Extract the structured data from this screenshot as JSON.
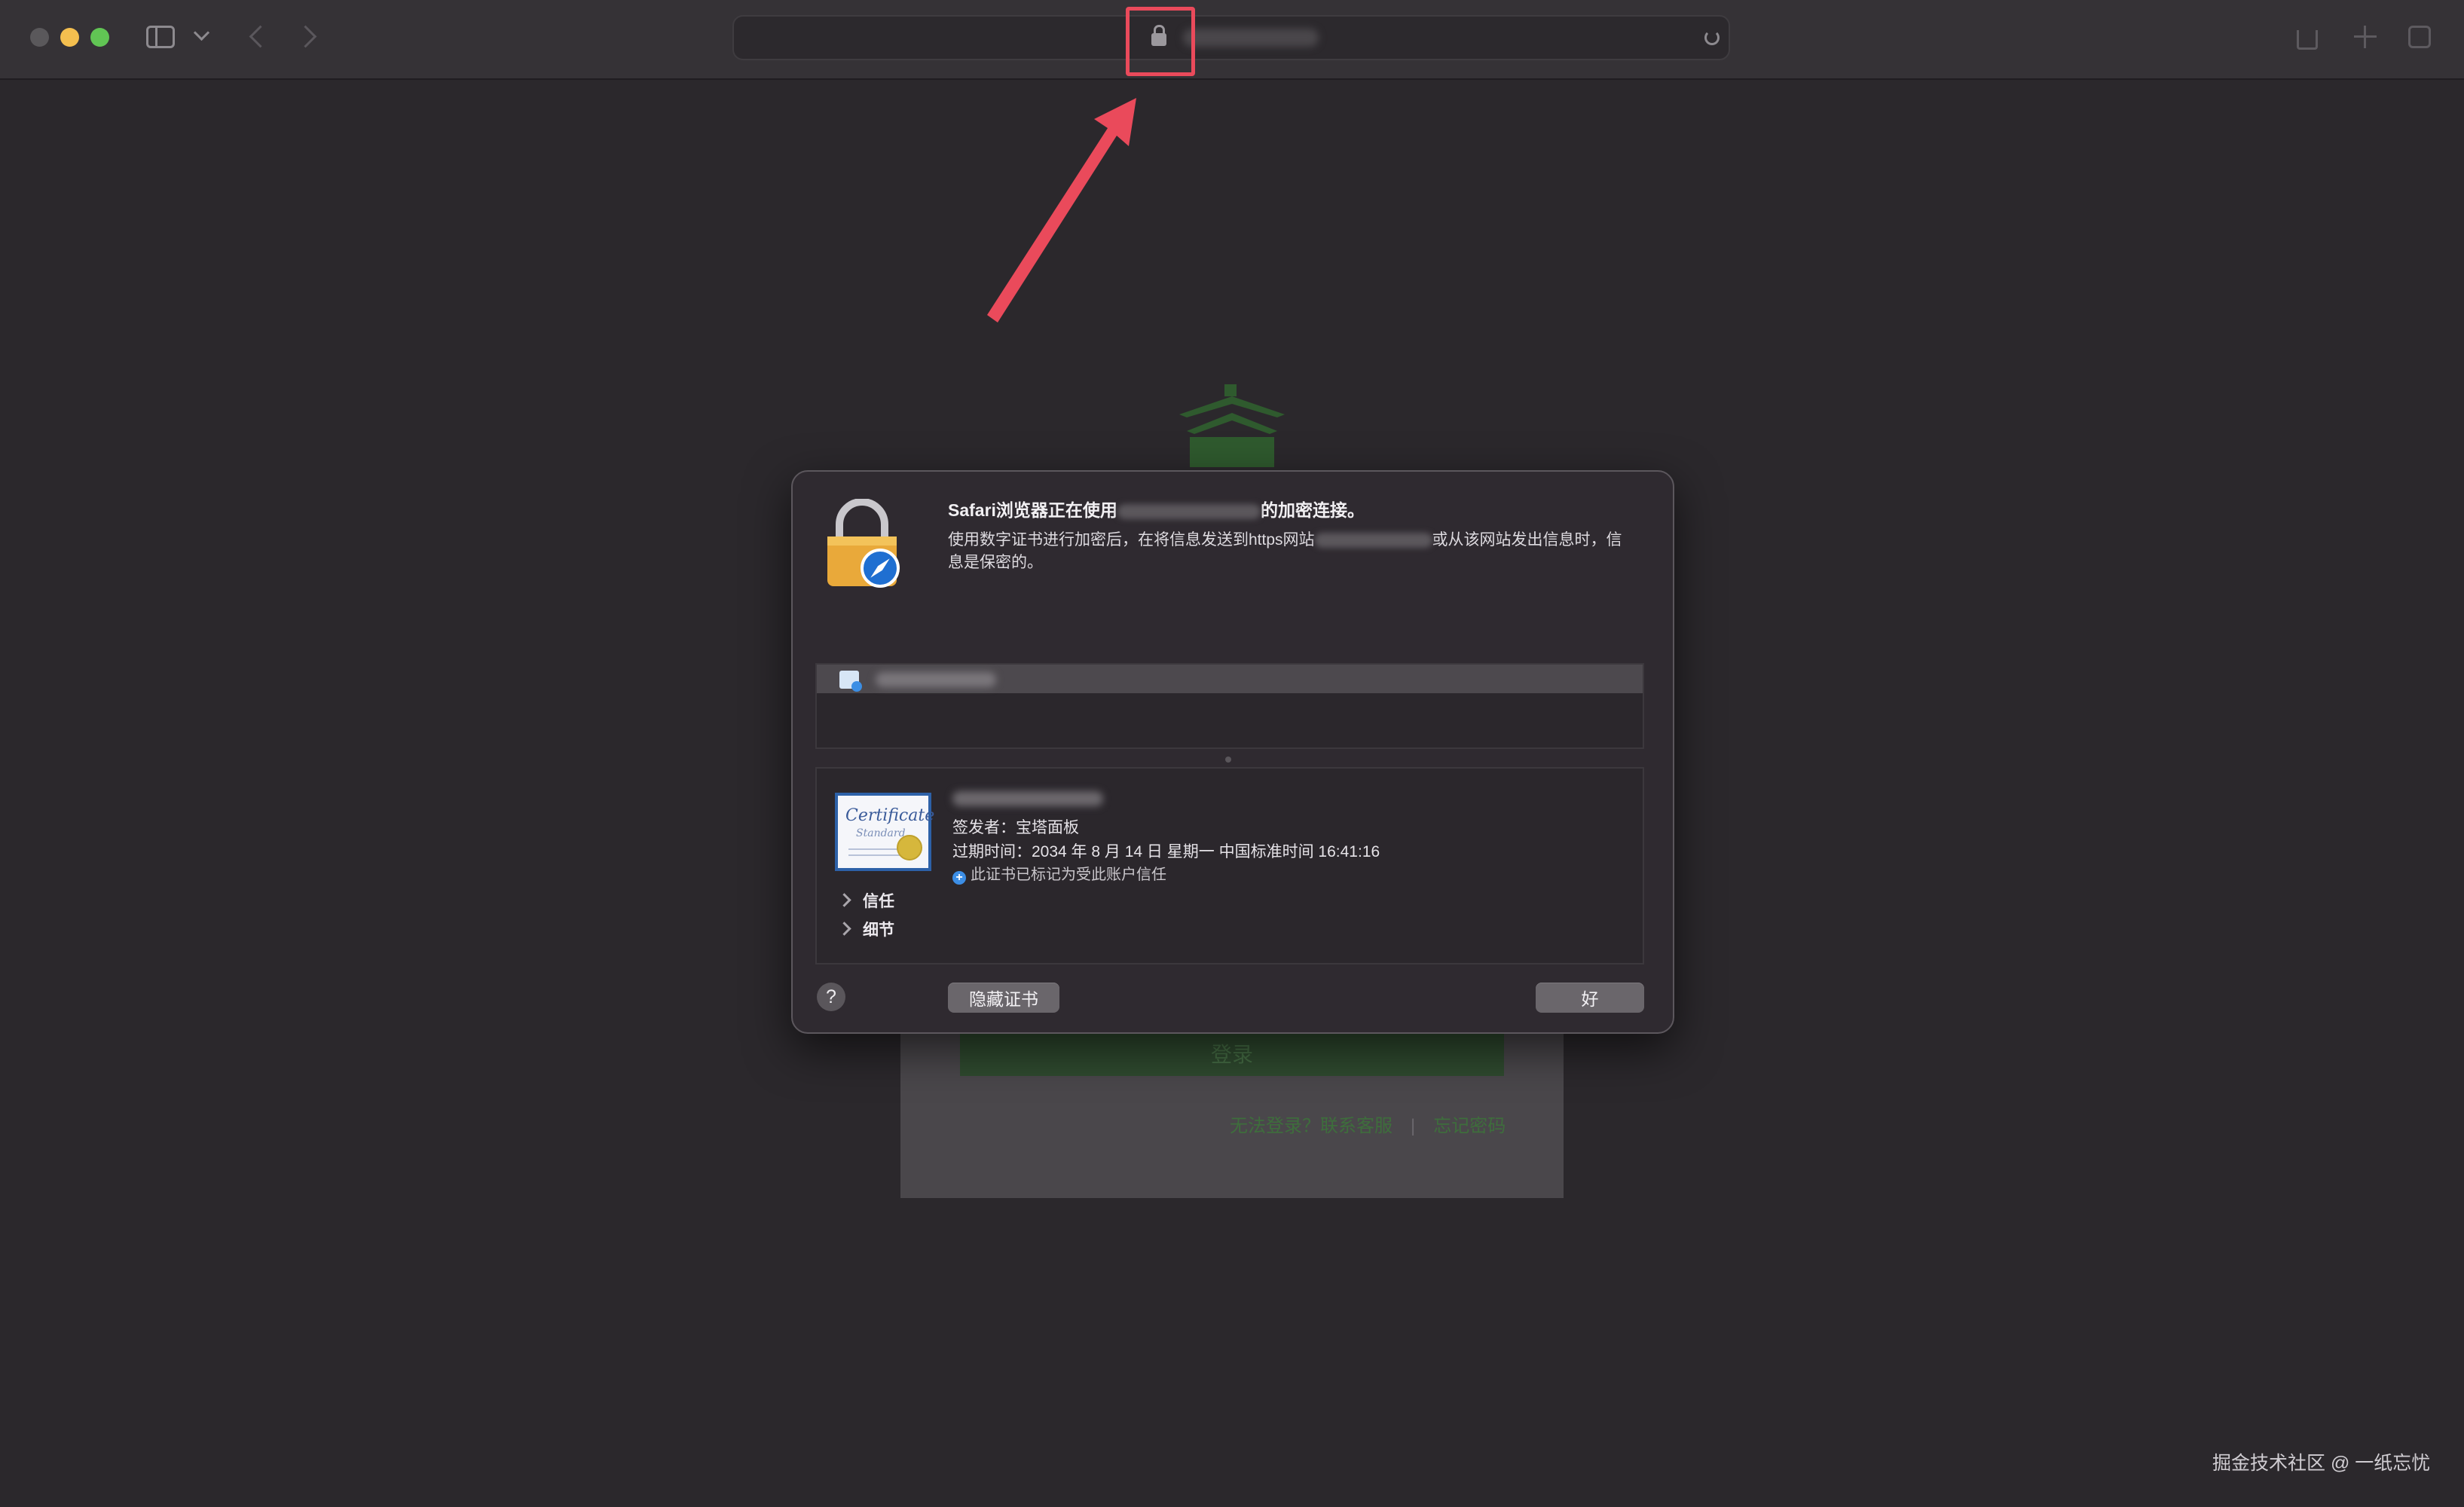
{
  "dialog": {
    "title_prefix": "Safari浏览器正在使用",
    "title_suffix": "的加密连接。",
    "desc_prefix": "使用数字证书进行加密后，在将信息发送到https网站",
    "desc_suffix": "或从该网站发出信息时，信息是保密的。",
    "issuer": "签发者：宝塔面板",
    "expiry": "过期时间：2034 年 8 月 14 日 星期一 中国标准时间 16:41:16",
    "trust_status": "此证书已标记为受此账户信任",
    "trust_label": "信任",
    "details_label": "细节",
    "help_label": "?",
    "hide_cert_label": "隐藏证书",
    "ok_label": "好"
  },
  "certificate_image": {
    "title": "Certificate",
    "subtitle": "Standard"
  },
  "background_page": {
    "login_label": "登录",
    "cannot_login": "无法登录？联系客服",
    "separator": "|",
    "forgot_password": "忘记密码"
  },
  "watermark": "掘金技术社区 @ 一纸忘忧",
  "colors": {
    "annotation_red": "#ea4a5b",
    "trust_badge_blue": "#3c8ee6",
    "brand_green": "#3e6e3c"
  },
  "icons": {
    "address_lock": "lock-icon",
    "dialog_lock": "safari-lock-icon",
    "certificate_row": "certificate-icon"
  }
}
